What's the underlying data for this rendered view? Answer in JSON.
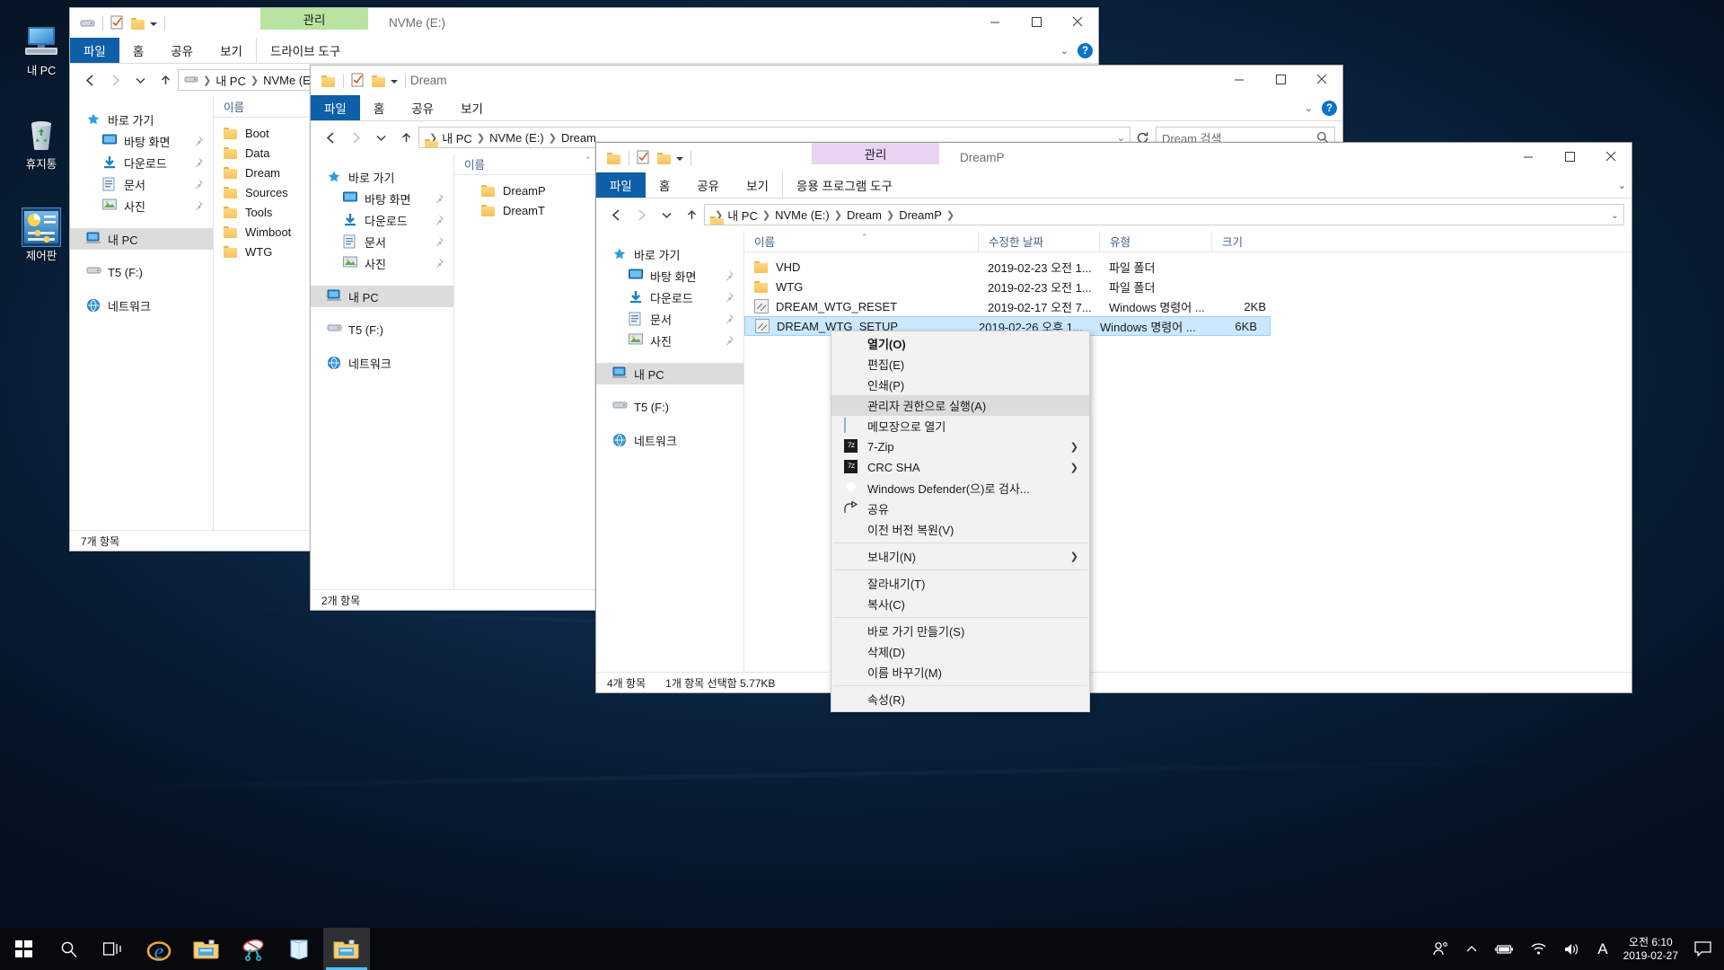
{
  "desktop": {
    "icons": [
      {
        "name": "내 PC",
        "icon": "this-pc-icon",
        "selected": false
      },
      {
        "name": "휴지통",
        "icon": "recycle-bin-icon",
        "selected": false
      },
      {
        "name": "제어판",
        "icon": "control-panel-icon",
        "selected": true
      }
    ]
  },
  "window1": {
    "title": "NVMe (E:)",
    "contextual_tab_group": "드라이브 도구",
    "contextual_tab_label": "관리",
    "contextual_tab_color": "#b9e3a0",
    "ribbon_tabs": [
      "파일",
      "홈",
      "공유",
      "보기"
    ],
    "address": [
      "내 PC",
      "NVMe (E:)"
    ],
    "nav": {
      "quick_access": "바로 가기",
      "quick_items": [
        "바탕 화면",
        "다운로드",
        "문서",
        "사진"
      ],
      "this_pc": "내 PC",
      "drives": [
        "T5 (F:)"
      ],
      "network": "네트워크"
    },
    "column_header": "이름",
    "files": [
      "Boot",
      "Data",
      "Dream",
      "Sources",
      "Tools",
      "Wimboot",
      "WTG"
    ],
    "status": "7개 항목"
  },
  "window2": {
    "title": "Dream",
    "ribbon_tabs": [
      "파일",
      "홈",
      "공유",
      "보기"
    ],
    "address": [
      "내 PC",
      "NVMe (E:)",
      "Dream"
    ],
    "search_placeholder": "Dream 검색",
    "nav": {
      "quick_access": "바로 가기",
      "quick_items": [
        "바탕 화면",
        "다운로드",
        "문서",
        "사진"
      ],
      "this_pc": "내 PC",
      "drives": [
        "T5 (F:)"
      ],
      "network": "네트워크"
    },
    "column_header": "이름",
    "files": [
      "DreamP",
      "DreamT"
    ],
    "status": "2개 항목"
  },
  "window3": {
    "title": "DreamP",
    "contextual_tab_group": "응용 프로그램 도구",
    "contextual_tab_label": "관리",
    "contextual_tab_color": "#e9d3f2",
    "ribbon_tabs": [
      "파일",
      "홈",
      "공유",
      "보기"
    ],
    "address": [
      "내 PC",
      "NVMe (E:)",
      "Dream",
      "DreamP"
    ],
    "nav": {
      "quick_access": "바로 가기",
      "quick_items": [
        "바탕 화면",
        "다운로드",
        "문서",
        "사진"
      ],
      "this_pc": "내 PC",
      "drives": [
        "T5 (F:)"
      ],
      "network": "네트워크"
    },
    "columns": [
      "이름",
      "수정한 날짜",
      "유형",
      "크기"
    ],
    "rows": [
      {
        "name": "VHD",
        "icon": "folder-icon",
        "date": "2019-02-23 오전 1...",
        "type": "파일 폴더",
        "size": "",
        "selected": false
      },
      {
        "name": "WTG",
        "icon": "folder-icon",
        "date": "2019-02-23 오전 1...",
        "type": "파일 폴더",
        "size": "",
        "selected": false
      },
      {
        "name": "DREAM_WTG_RESET",
        "icon": "batch-file-icon",
        "date": "2019-02-17 오전 7...",
        "type": "Windows 명령어 ...",
        "size": "2KB",
        "selected": false
      },
      {
        "name": "DREAM_WTG_SETUP",
        "icon": "batch-file-icon",
        "date": "2019-02-26 오후 1...",
        "type": "Windows 명령어 ...",
        "size": "6KB",
        "selected": true
      }
    ],
    "status_count": "4개 항목",
    "status_selection": "1개 항목 선택함 5.77KB"
  },
  "context_menu": {
    "items": [
      {
        "label": "열기(O)",
        "icon": "",
        "bold": true,
        "highlight": false,
        "submenu": false
      },
      {
        "label": "편집(E)",
        "icon": "",
        "bold": false,
        "highlight": false,
        "submenu": false
      },
      {
        "label": "인쇄(P)",
        "icon": "",
        "bold": false,
        "highlight": false,
        "submenu": false
      },
      {
        "label": "관리자 권한으로 실행(A)",
        "icon": "shield-icon",
        "bold": false,
        "highlight": true,
        "submenu": false
      },
      {
        "label": "메모장으로 열기",
        "icon": "notepad-icon",
        "bold": false,
        "highlight": false,
        "submenu": false
      },
      {
        "separator_before": false,
        "label": "7-Zip",
        "icon": "seven-zip-icon",
        "bold": false,
        "highlight": false,
        "submenu": true
      },
      {
        "label": "CRC SHA",
        "icon": "seven-zip-icon",
        "bold": false,
        "highlight": false,
        "submenu": true
      },
      {
        "label": "Windows Defender(으)로 검사...",
        "icon": "defender-icon",
        "bold": false,
        "highlight": false,
        "submenu": false
      },
      {
        "label": "공유",
        "icon": "share-icon",
        "bold": false,
        "highlight": false,
        "submenu": false
      },
      {
        "label": "이전 버전 복원(V)",
        "icon": "",
        "bold": false,
        "highlight": false,
        "submenu": false
      },
      {
        "separator_before": true,
        "label": "보내기(N)",
        "icon": "",
        "bold": false,
        "highlight": false,
        "submenu": true
      },
      {
        "separator_before": true,
        "label": "잘라내기(T)",
        "icon": "",
        "bold": false,
        "highlight": false,
        "submenu": false
      },
      {
        "label": "복사(C)",
        "icon": "",
        "bold": false,
        "highlight": false,
        "submenu": false
      },
      {
        "separator_before": true,
        "label": "바로 가기 만들기(S)",
        "icon": "",
        "bold": false,
        "highlight": false,
        "submenu": false
      },
      {
        "label": "삭제(D)",
        "icon": "",
        "bold": false,
        "highlight": false,
        "submenu": false
      },
      {
        "label": "이름 바꾸기(M)",
        "icon": "",
        "bold": false,
        "highlight": false,
        "submenu": false
      },
      {
        "separator_before": true,
        "label": "속성(R)",
        "icon": "",
        "bold": false,
        "highlight": false,
        "submenu": false
      }
    ]
  },
  "taskbar": {
    "buttons": [
      {
        "name": "start-button",
        "icon": "windows-logo-icon"
      },
      {
        "name": "search-button",
        "icon": "search-icon"
      },
      {
        "name": "task-view-button",
        "icon": "task-view-icon"
      },
      {
        "name": "internet-explorer-button",
        "icon": "internet-explorer-icon"
      },
      {
        "name": "file-explorer-button",
        "icon": "folder-icon"
      },
      {
        "name": "snipping-tool-button",
        "icon": "snipping-tool-icon"
      },
      {
        "name": "notepad-button",
        "icon": "notepad-icon"
      },
      {
        "name": "file-explorer-active-button",
        "icon": "folder-icon"
      }
    ],
    "tray": {
      "people_icon": "people-icon",
      "chevron_icon": "chevron-up-icon",
      "battery_icon": "battery-icon",
      "wifi_icon": "wifi-icon",
      "volume_icon": "volume-icon",
      "ime_indicator": "A",
      "time": "오전 6:10",
      "date": "2019-02-27",
      "action_center_icon": "action-center-icon"
    }
  },
  "colors": {
    "accent": "#0d5fa8",
    "selection": "#cce8ff",
    "file_tab": "#0d5fa8",
    "manage_green": "#b9e3a0",
    "manage_purple": "#e9d3f2"
  }
}
